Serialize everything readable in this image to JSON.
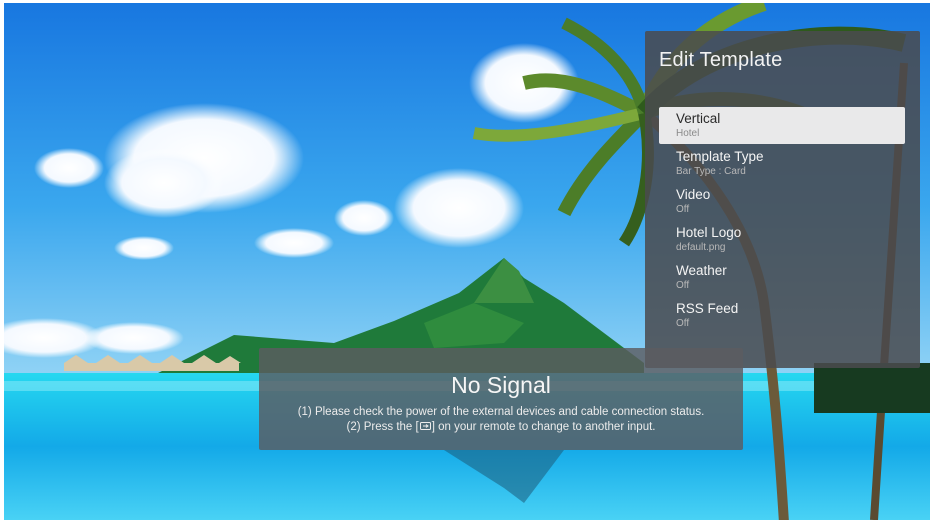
{
  "panel": {
    "title": "Edit Template",
    "items": [
      {
        "label": "Vertical",
        "value": "Hotel",
        "selected": true
      },
      {
        "label": "Template Type",
        "value": "Bar Type : Card",
        "selected": false
      },
      {
        "label": "Video",
        "value": "Off",
        "selected": false
      },
      {
        "label": "Hotel Logo",
        "value": "default.png",
        "selected": false
      },
      {
        "label": "Weather",
        "value": "Off",
        "selected": false
      },
      {
        "label": "RSS Feed",
        "value": "Off",
        "selected": false
      }
    ]
  },
  "no_signal": {
    "title": "No Signal",
    "line1": "(1) Please check the power of the external devices and cable connection status.",
    "line2_before": "(2) Press the [",
    "line2_icon": "input-source-icon",
    "line2_after": "] on your remote to change to another input."
  },
  "colors": {
    "sky": "#1f86e6",
    "water": "#17c9ee",
    "panel": "#4a4a4e",
    "selected_row": "#e9e9ea"
  }
}
